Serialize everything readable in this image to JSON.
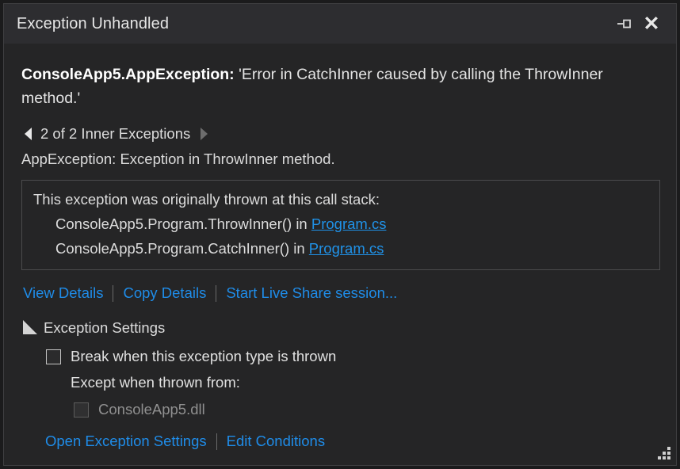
{
  "window": {
    "title": "Exception Unhandled",
    "pin_icon": "pin-icon",
    "close_icon": "close-icon"
  },
  "exception": {
    "type": "ConsoleApp5.AppException:",
    "message": "'Error in CatchInner caused by calling the ThrowInner method.'"
  },
  "inner_exceptions": {
    "prev_icon": "arrow-left-icon",
    "next_icon": "arrow-right-icon",
    "counter": "2 of 2 Inner Exceptions",
    "detail": "AppException: Exception in ThrowInner method."
  },
  "call_stack": {
    "title": "This exception was originally thrown at this call stack:",
    "frames": [
      {
        "method": "ConsoleApp5.Program.ThrowInner() in ",
        "file": "Program.cs"
      },
      {
        "method": "ConsoleApp5.Program.CatchInner() in ",
        "file": "Program.cs"
      }
    ]
  },
  "actions": {
    "view_details": "View Details",
    "copy_details": "Copy Details",
    "live_share": "Start Live Share session..."
  },
  "settings": {
    "expander_icon": "triangle-expanded-icon",
    "header": "Exception Settings",
    "break_checkbox_label": "Break when this exception type is thrown",
    "break_checked": false,
    "except_when_label": "Except when thrown from:",
    "module_label": "ConsoleApp5.dll",
    "module_checked": false,
    "open_settings": "Open Exception Settings",
    "edit_conditions": "Edit Conditions"
  },
  "colors": {
    "link": "#1f8ce8",
    "file_link": "#2092e8",
    "titlebar_bg": "#2d2d30",
    "body_bg": "#252526",
    "text": "#dcdcdc",
    "disabled_text": "#909090"
  },
  "resize_grip": "resize-grip-icon"
}
